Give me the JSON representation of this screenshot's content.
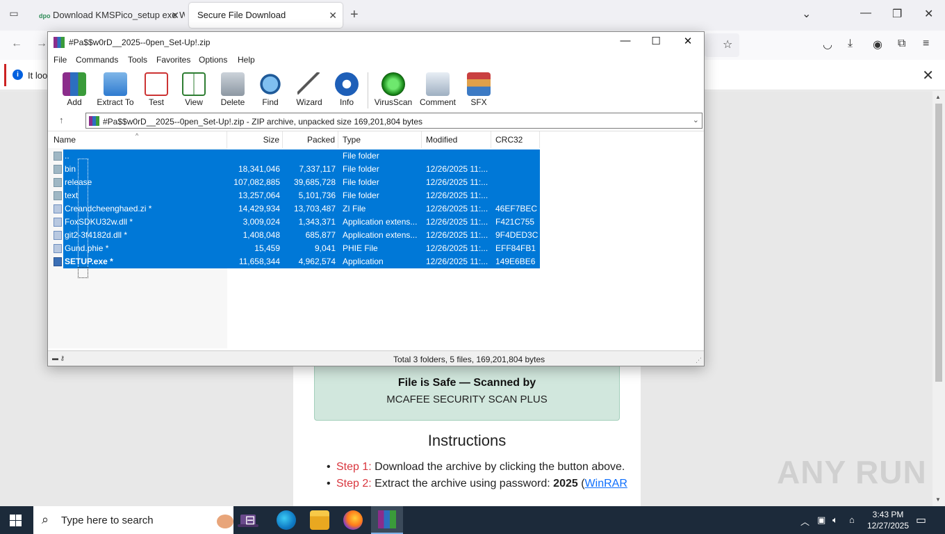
{
  "browser": {
    "tabs": [
      {
        "label": "Download KMSPico_setup exe W",
        "favicon": "dpo"
      },
      {
        "label": "Secure File Download"
      }
    ],
    "notification_text": "It loo"
  },
  "webpage": {
    "safe_title": "File is Safe — Scanned by",
    "safe_subtitle": "MCAFEE SECURITY SCAN PLUS",
    "instructions_heading": "Instructions",
    "step1_label": "Step 1:",
    "step1_text": "Download the archive by clicking the button above.",
    "step2_label": "Step 2:",
    "step2_text": "Extract the archive using password:",
    "step2_password": "2025",
    "step2_paren": "(",
    "step2_link": "WinRAR"
  },
  "watermark": "ANY RUN",
  "winrar": {
    "title": "#Pa$$w0rD__2025--0pen_Set-Up!.zip",
    "menu": [
      "File",
      "Commands",
      "Tools",
      "Favorites",
      "Options",
      "Help"
    ],
    "toolbar": [
      "Add",
      "Extract To",
      "Test",
      "View",
      "Delete",
      "Find",
      "Wizard",
      "Info",
      "VirusScan",
      "Comment",
      "SFX"
    ],
    "address": "#Pa$$w0rD__2025--0pen_Set-Up!.zip - ZIP archive, unpacked size 169,201,804 bytes",
    "columns": [
      "Name",
      "Size",
      "Packed",
      "Type",
      "Modified",
      "CRC32"
    ],
    "rows": [
      {
        "name": "..",
        "size": "",
        "packed": "",
        "type": "File folder",
        "modified": "",
        "crc": ""
      },
      {
        "name": "bin",
        "size": "18,341,046",
        "packed": "7,337,117",
        "type": "File folder",
        "modified": "12/26/2025 11:...",
        "crc": ""
      },
      {
        "name": "release",
        "size": "107,082,885",
        "packed": "39,685,728",
        "type": "File folder",
        "modified": "12/26/2025 11:...",
        "crc": ""
      },
      {
        "name": "text",
        "size": "13,257,064",
        "packed": "5,101,736",
        "type": "File folder",
        "modified": "12/26/2025 11:...",
        "crc": ""
      },
      {
        "name": "Creandcheenghaed.zi *",
        "size": "14,429,934",
        "packed": "13,703,487",
        "type": "ZI File",
        "modified": "12/26/2025 11:...",
        "crc": "46EF7BEC"
      },
      {
        "name": "FoxSDKU32w.dll *",
        "size": "3,009,024",
        "packed": "1,343,371",
        "type": "Application extens...",
        "modified": "12/26/2025 11:...",
        "crc": "F421C755"
      },
      {
        "name": "git2-3f4182d.dll *",
        "size": "1,408,048",
        "packed": "685,877",
        "type": "Application extens...",
        "modified": "12/26/2025 11:...",
        "crc": "9F4DED3C"
      },
      {
        "name": "Gund.phie *",
        "size": "15,459",
        "packed": "9,041",
        "type": "PHIE File",
        "modified": "12/26/2025 11:...",
        "crc": "EFF84FB1"
      },
      {
        "name": "SETUP.exe *",
        "size": "11,658,344",
        "packed": "4,962,574",
        "type": "Application",
        "modified": "12/26/2025 11:...",
        "crc": "149E6BE6"
      }
    ],
    "status": "Total 3 folders, 5 files, 169,201,804 bytes"
  },
  "taskbar": {
    "search_placeholder": "Type here to search",
    "time": "3:43 PM",
    "date": "12/27/2025"
  }
}
